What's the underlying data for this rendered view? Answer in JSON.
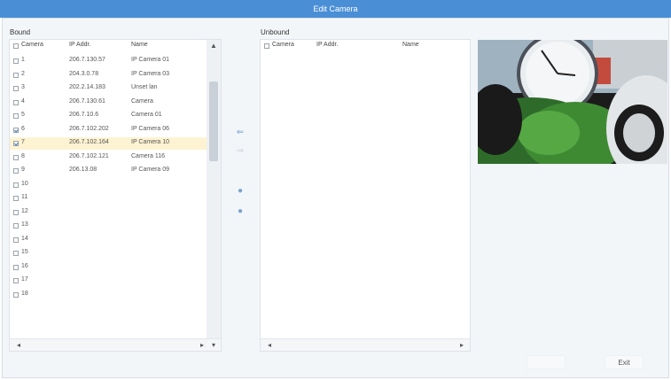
{
  "window": {
    "title": "Edit Camera"
  },
  "bound": {
    "label": "Bound",
    "columns": {
      "camera": "Camera",
      "ip": "IP Addr.",
      "name": "Name"
    },
    "rows": [
      {
        "camera": "1",
        "ip": "206.7.130.57",
        "name": "IP Camera 01",
        "checked": false,
        "selected": false
      },
      {
        "camera": "2",
        "ip": "204.3.0.78",
        "name": "IP Camera 03",
        "checked": false,
        "selected": false
      },
      {
        "camera": "3",
        "ip": "202.2.14.183",
        "name": "Unset lan",
        "checked": false,
        "selected": false
      },
      {
        "camera": "4",
        "ip": "206.7.130.61",
        "name": "Camera",
        "checked": false,
        "selected": false
      },
      {
        "camera": "5",
        "ip": "206.7.10.6",
        "name": "Camera 01",
        "checked": false,
        "selected": false
      },
      {
        "camera": "6",
        "ip": "206.7.102.202",
        "name": "IP Camera 06",
        "checked": true,
        "selected": false
      },
      {
        "camera": "7",
        "ip": "206.7.102.164",
        "name": "IP Camera 10",
        "checked": true,
        "selected": true
      },
      {
        "camera": "8",
        "ip": "206.7.102.121",
        "name": "Camera 116",
        "checked": false,
        "selected": false
      },
      {
        "camera": "9",
        "ip": "206.13.08",
        "name": "IP Camera 09",
        "checked": false,
        "selected": false
      },
      {
        "camera": "10",
        "ip": "",
        "name": "",
        "checked": false,
        "selected": false
      },
      {
        "camera": "11",
        "ip": "",
        "name": "",
        "checked": false,
        "selected": false
      },
      {
        "camera": "12",
        "ip": "",
        "name": "",
        "checked": false,
        "selected": false
      },
      {
        "camera": "13",
        "ip": "",
        "name": "",
        "checked": false,
        "selected": false
      },
      {
        "camera": "14",
        "ip": "",
        "name": "",
        "checked": false,
        "selected": false
      },
      {
        "camera": "15",
        "ip": "",
        "name": "",
        "checked": false,
        "selected": false
      },
      {
        "camera": "16",
        "ip": "",
        "name": "",
        "checked": false,
        "selected": false
      },
      {
        "camera": "17",
        "ip": "",
        "name": "",
        "checked": false,
        "selected": false
      },
      {
        "camera": "18",
        "ip": "",
        "name": "",
        "checked": false,
        "selected": false
      }
    ],
    "scroll_position": 0.15
  },
  "unbound": {
    "label": "Unbound",
    "columns": {
      "camera": "Camera",
      "ip": "IP Addr.",
      "name": "Name"
    }
  },
  "controls": {
    "bind_icon": "arrow-left-icon",
    "unbind_icon": "arrow-right-icon",
    "move_up_icon": "move-up-icon",
    "move_down_icon": "move-down-icon"
  },
  "buttons": {
    "ok": "",
    "exit": "Exit"
  },
  "colors": {
    "titlebar": "#4a8fd6",
    "selected_row": "#fdf3d2"
  }
}
